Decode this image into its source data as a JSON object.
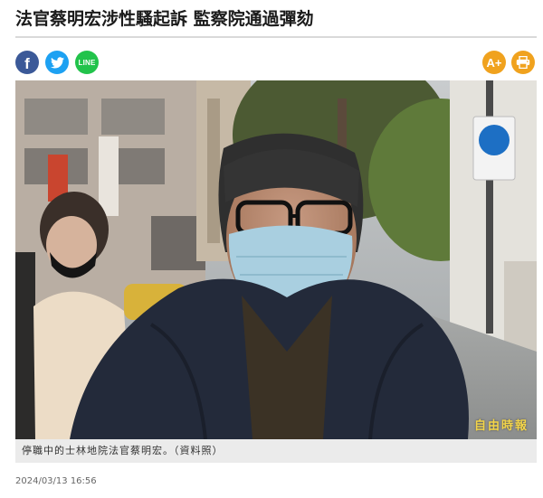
{
  "article": {
    "title": "法官蔡明宏涉性騷起訴 監察院通過彈劾",
    "photo_caption": "停職中的士林地院法官蔡明宏。（資料照）",
    "photo_watermark": "自由時報",
    "timestamp": "2024/03/13 16:56"
  },
  "share": [
    {
      "name": "facebook",
      "icon": "facebook-icon",
      "color": "#3b5998"
    },
    {
      "name": "twitter",
      "icon": "twitter-icon",
      "color": "#1da1f2"
    },
    {
      "name": "line",
      "icon": "line-icon",
      "label": "LINE",
      "color": "#22c34b"
    }
  ],
  "tools": [
    {
      "name": "font-size",
      "icon": "font-size-icon",
      "label": "A+",
      "color": "#f0a21e"
    },
    {
      "name": "print",
      "icon": "print-icon",
      "color": "#f0a21e"
    }
  ]
}
